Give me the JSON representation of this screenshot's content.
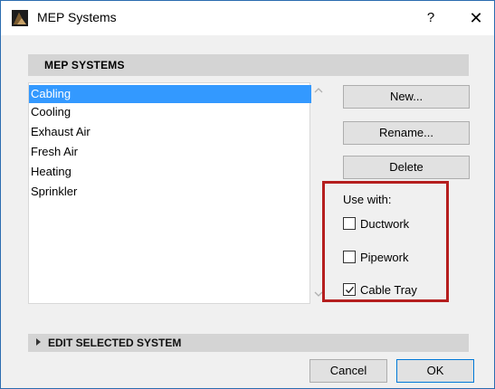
{
  "window": {
    "title": "MEP Systems",
    "help_label": "?",
    "close_label": "✕"
  },
  "section": {
    "title": "MEP SYSTEMS"
  },
  "systems_list": {
    "items": [
      {
        "label": "Cabling",
        "selected": true
      },
      {
        "label": "Cooling",
        "selected": false
      },
      {
        "label": "Exhaust Air",
        "selected": false
      },
      {
        "label": "Fresh Air",
        "selected": false
      },
      {
        "label": "Heating",
        "selected": false
      },
      {
        "label": "Sprinkler",
        "selected": false
      }
    ]
  },
  "actions": {
    "new_label": "New...",
    "rename_label": "Rename...",
    "delete_label": "Delete"
  },
  "use_with": {
    "label": "Use with:",
    "options": [
      {
        "label": "Ductwork",
        "checked": false
      },
      {
        "label": "Pipework",
        "checked": false
      },
      {
        "label": "Cable Tray",
        "checked": true
      }
    ]
  },
  "edit_section": {
    "title": "EDIT SELECTED SYSTEM"
  },
  "footer": {
    "cancel_label": "Cancel",
    "ok_label": "OK"
  },
  "colors": {
    "selection": "#3399ff",
    "highlight_border": "#b51e1e",
    "section_header": "#d4d4d4"
  }
}
